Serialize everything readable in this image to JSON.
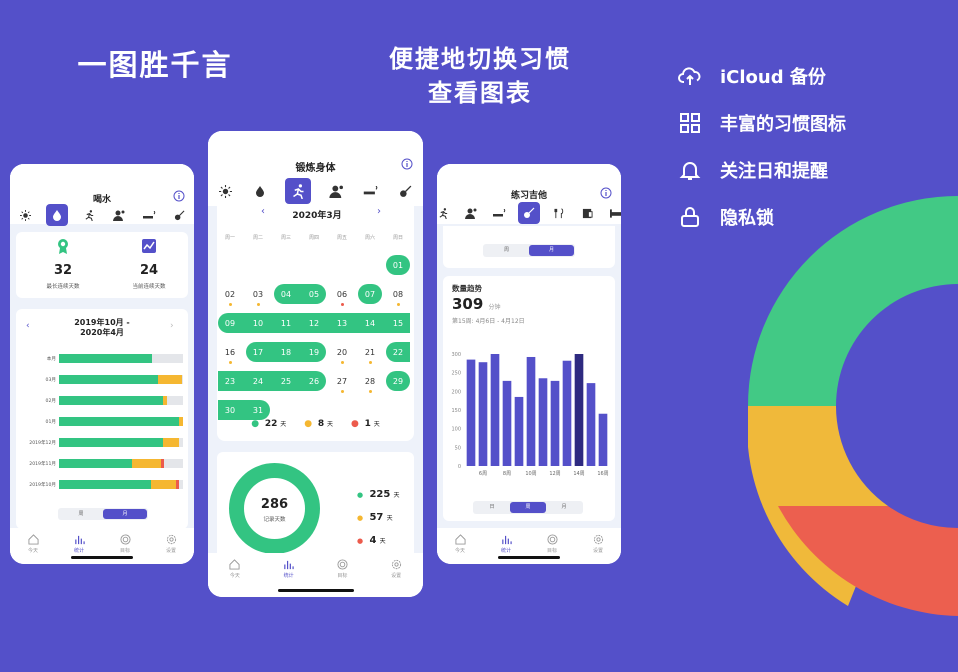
{
  "headlines": {
    "left": "一图胜千言",
    "center_line1": "便捷地切换习惯",
    "center_line2": "查看图表"
  },
  "features": [
    {
      "icon": "cloud-upload-icon",
      "label": "iCloud 备份"
    },
    {
      "icon": "grid-icon",
      "label": "丰富的习惯图标"
    },
    {
      "icon": "bell-icon",
      "label": "关注日和提醒"
    },
    {
      "icon": "lock-icon",
      "label": "隐私锁"
    }
  ],
  "colors": {
    "background": "#5450c9",
    "accent": "#5450c9",
    "green": "#33c482",
    "yellow": "#f5b731",
    "red": "#ec5b4c",
    "grey": "#e4e6ea"
  },
  "tabbar": {
    "today": "今天",
    "stats": "统计",
    "goals": "目标",
    "settings": "设置"
  },
  "phone1": {
    "title": "喝水",
    "best_streak": {
      "value": "32",
      "label": "最长连续天数"
    },
    "current_streak": {
      "value": "24",
      "label": "当前连续天数"
    },
    "range_title": "2019年10月 -\n2020年4月",
    "range_line1": "2019年10月 -",
    "range_line2": "2020年4月",
    "segment": {
      "week": "周",
      "month": "月"
    },
    "bars": [
      {
        "label": "本月",
        "green": 0.75,
        "yellow": 0,
        "red": 0
      },
      {
        "label": "03月",
        "green": 0.8,
        "yellow": 0.19,
        "red": 0
      },
      {
        "label": "02月",
        "green": 0.84,
        "yellow": 0.03,
        "red": 0
      },
      {
        "label": "01月",
        "green": 0.97,
        "yellow": 0.03,
        "red": 0
      },
      {
        "label": "2019年12月",
        "green": 0.84,
        "yellow": 0.13,
        "red": 0
      },
      {
        "label": "2019年11月",
        "green": 0.59,
        "yellow": 0.23,
        "red": 0.03
      },
      {
        "label": "2019年10月",
        "green": 0.74,
        "yellow": 0.2,
        "red": 0.03
      }
    ]
  },
  "phone2": {
    "title": "锻炼身体",
    "month": "2020年3月",
    "weekdays": [
      "周一",
      "周二",
      "周三",
      "周四",
      "周五",
      "周六",
      "周日"
    ],
    "legend": [
      {
        "value": "22",
        "unit": "天",
        "color": "#33c482"
      },
      {
        "value": "8",
        "unit": "天",
        "color": "#f5b731"
      },
      {
        "value": "1",
        "unit": "天",
        "color": "#ec5b4c"
      }
    ],
    "donut": {
      "total": "286",
      "label": "记录天数"
    },
    "donut_legend": [
      {
        "value": "225",
        "unit": "天",
        "color": "#33c482"
      },
      {
        "value": "57",
        "unit": "天",
        "color": "#f5b731"
      },
      {
        "value": "4",
        "unit": "天",
        "color": "#ec5b4c"
      }
    ]
  },
  "phone3": {
    "title": "练习吉他",
    "segment": {
      "week": "周",
      "month": "月"
    },
    "section_title": "数量趋势",
    "value": "309",
    "unit": "分钟",
    "period": "第15周: 4月6日 - 4月12日",
    "bottom_segment": {
      "day": "日",
      "week": "周",
      "month": "月"
    }
  },
  "chart_data": {
    "type": "bar",
    "categories": [
      "",
      "6周",
      "",
      "8周",
      "",
      "10周",
      "",
      "12周",
      "",
      "14周",
      "",
      "16周"
    ],
    "values": [
      285,
      278,
      302,
      228,
      185,
      292,
      235,
      228,
      282,
      306,
      222,
      140
    ],
    "highlight_index": 9,
    "ylim": [
      0,
      300
    ],
    "yticks": [
      "300",
      "250",
      "200",
      "150",
      "100",
      "50",
      "0"
    ]
  }
}
